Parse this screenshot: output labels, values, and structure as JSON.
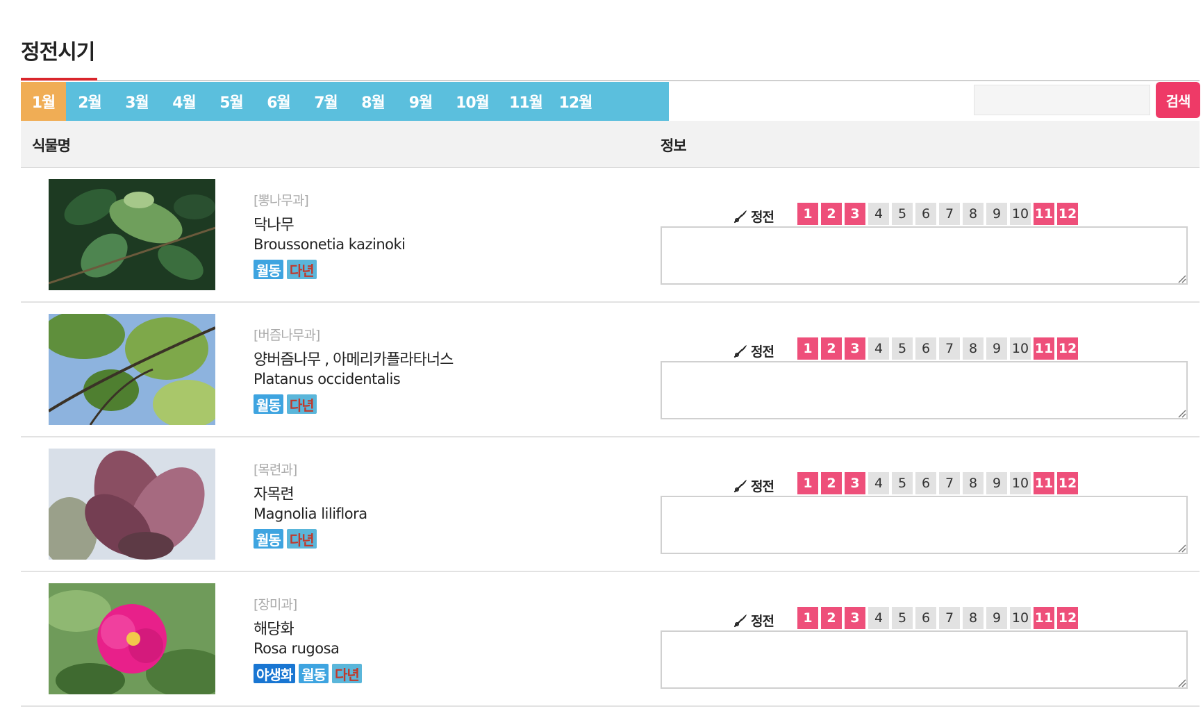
{
  "page": {
    "title": "정전시기"
  },
  "tabs": [
    {
      "label": "1월",
      "active": true
    },
    {
      "label": "2월",
      "active": false
    },
    {
      "label": "3월",
      "active": false
    },
    {
      "label": "4월",
      "active": false
    },
    {
      "label": "5월",
      "active": false
    },
    {
      "label": "6월",
      "active": false
    },
    {
      "label": "7월",
      "active": false
    },
    {
      "label": "8월",
      "active": false
    },
    {
      "label": "9월",
      "active": false
    },
    {
      "label": "10월",
      "active": false
    },
    {
      "label": "11월",
      "active": false
    },
    {
      "label": "12월",
      "active": false
    }
  ],
  "search": {
    "value": "",
    "placeholder": "",
    "button_label": "검색"
  },
  "table": {
    "col_name": "식물명",
    "col_info": "정보"
  },
  "colors": {
    "tab_bg": "#5bbfdd",
    "tab_active": "#f0ad55",
    "search_button": "#ee3a67",
    "month_on": "#ee4f7a",
    "month_off": "#e2e2e2",
    "title_accent": "#d9262c"
  },
  "pruning_label": "정전",
  "pruning_icon": "pruning-shears-icon",
  "months": [
    "1",
    "2",
    "3",
    "4",
    "5",
    "6",
    "7",
    "8",
    "9",
    "10",
    "11",
    "12"
  ],
  "rows": [
    {
      "photo": "paper-mulberry-leaves-photo",
      "family": "[뽕나무과]",
      "kor_name": "닥나무",
      "sci_name": "Broussonetia kazinoki",
      "badges": [
        {
          "label": "월동",
          "style": "blue"
        },
        {
          "label": "다년",
          "style": "brown"
        }
      ],
      "pruning_months": [
        1,
        2,
        3,
        11,
        12
      ],
      "memo": ""
    },
    {
      "photo": "sycamore-branches-photo",
      "family": "[버즘나무과]",
      "kor_name": "양버즘나무 , 아메리카플라타너스",
      "sci_name": "Platanus occidentalis",
      "badges": [
        {
          "label": "월동",
          "style": "blue"
        },
        {
          "label": "다년",
          "style": "brown"
        }
      ],
      "pruning_months": [
        1,
        2,
        3,
        11,
        12
      ],
      "memo": ""
    },
    {
      "photo": "magnolia-flower-photo",
      "family": "[목련과]",
      "kor_name": "자목련",
      "sci_name": "Magnolia liliflora",
      "badges": [
        {
          "label": "월동",
          "style": "blue"
        },
        {
          "label": "다년",
          "style": "brown"
        }
      ],
      "pruning_months": [
        1,
        2,
        3,
        11,
        12
      ],
      "memo": ""
    },
    {
      "photo": "rugosa-rose-flower-photo",
      "family": "[장미과]",
      "kor_name": "해당화",
      "sci_name": "Rosa rugosa",
      "badges": [
        {
          "label": "야생화",
          "style": "navy"
        },
        {
          "label": "월동",
          "style": "blue"
        },
        {
          "label": "다년",
          "style": "brown"
        }
      ],
      "pruning_months": [
        1,
        2,
        3,
        11,
        12
      ],
      "memo": ""
    }
  ]
}
